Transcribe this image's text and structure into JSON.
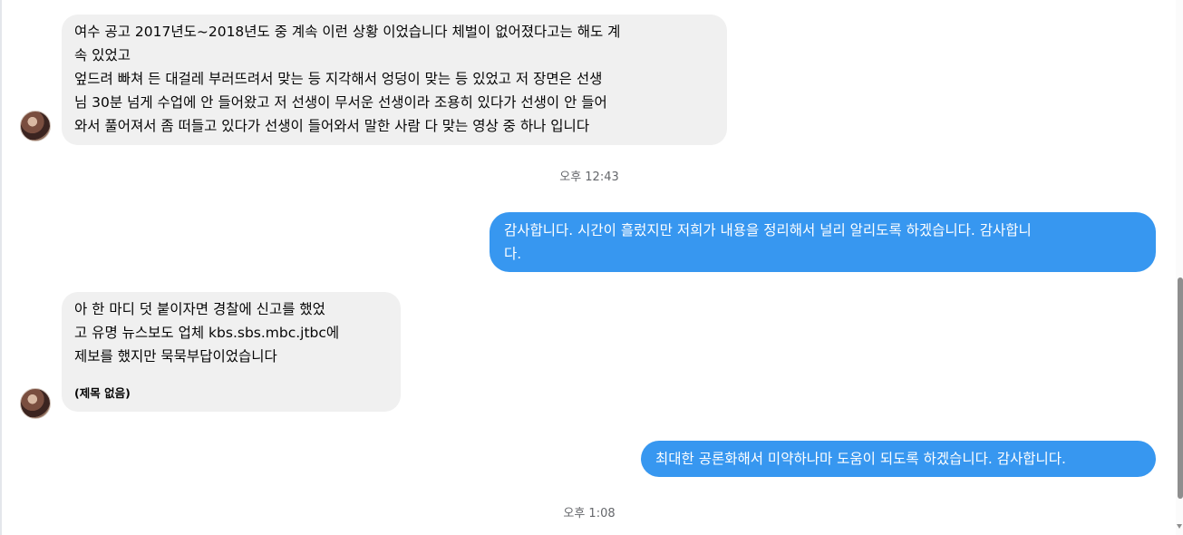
{
  "messages": [
    {
      "lines": [
        "여수 공고 2017년도~2018년도 중 계속 이런 상황 이었습니다 체벌이 없어졌다고는 해도 계",
        "속 있었고",
        "엎드려 빠쳐 든 대걸레 부러뜨려서 맞는 등 지각해서 엉덩이 맞는 등 있었고 저 장면은 선생",
        "님 30분 넘게 수업에 안 들어왔고 저 선생이 무서운 선생이라 조용히 있다가 선생이 안 들어",
        "와서 풀어져서 좀 떠들고 있다가 선생이 들어와서 말한 사람 다 맞는 영상 중 하나 입니다"
      ]
    },
    {
      "lines": [
        "감사합니다. 시간이 흘렀지만 저희가 내용을 정리해서 널리 알리도록 하겠습니다. 감사합니",
        "다."
      ]
    },
    {
      "lines": [
        "아 한 마디 덧 붙이자면 경찰에 신고를 했었",
        "고 유명 뉴스보도 업체 kbs.sbs.mbc.jtbc에",
        "제보를 했지만 묵묵부답이었습니다"
      ],
      "caption": "(제목 없음)"
    },
    {
      "lines": [
        "최대한 공론화해서 미약하나마 도움이 되도록 하겠습니다. 감사합니다."
      ]
    }
  ],
  "timestamps": [
    "오후 12:43",
    "오후 1:08"
  ],
  "colors": {
    "outgoing_bubble": "#3797f0",
    "incoming_bubble": "#f0f0f0",
    "timestamp_text": "#65676b"
  },
  "icons": {
    "avatar": "profile-photo",
    "scroll_arrow": "chevron-down-icon"
  }
}
